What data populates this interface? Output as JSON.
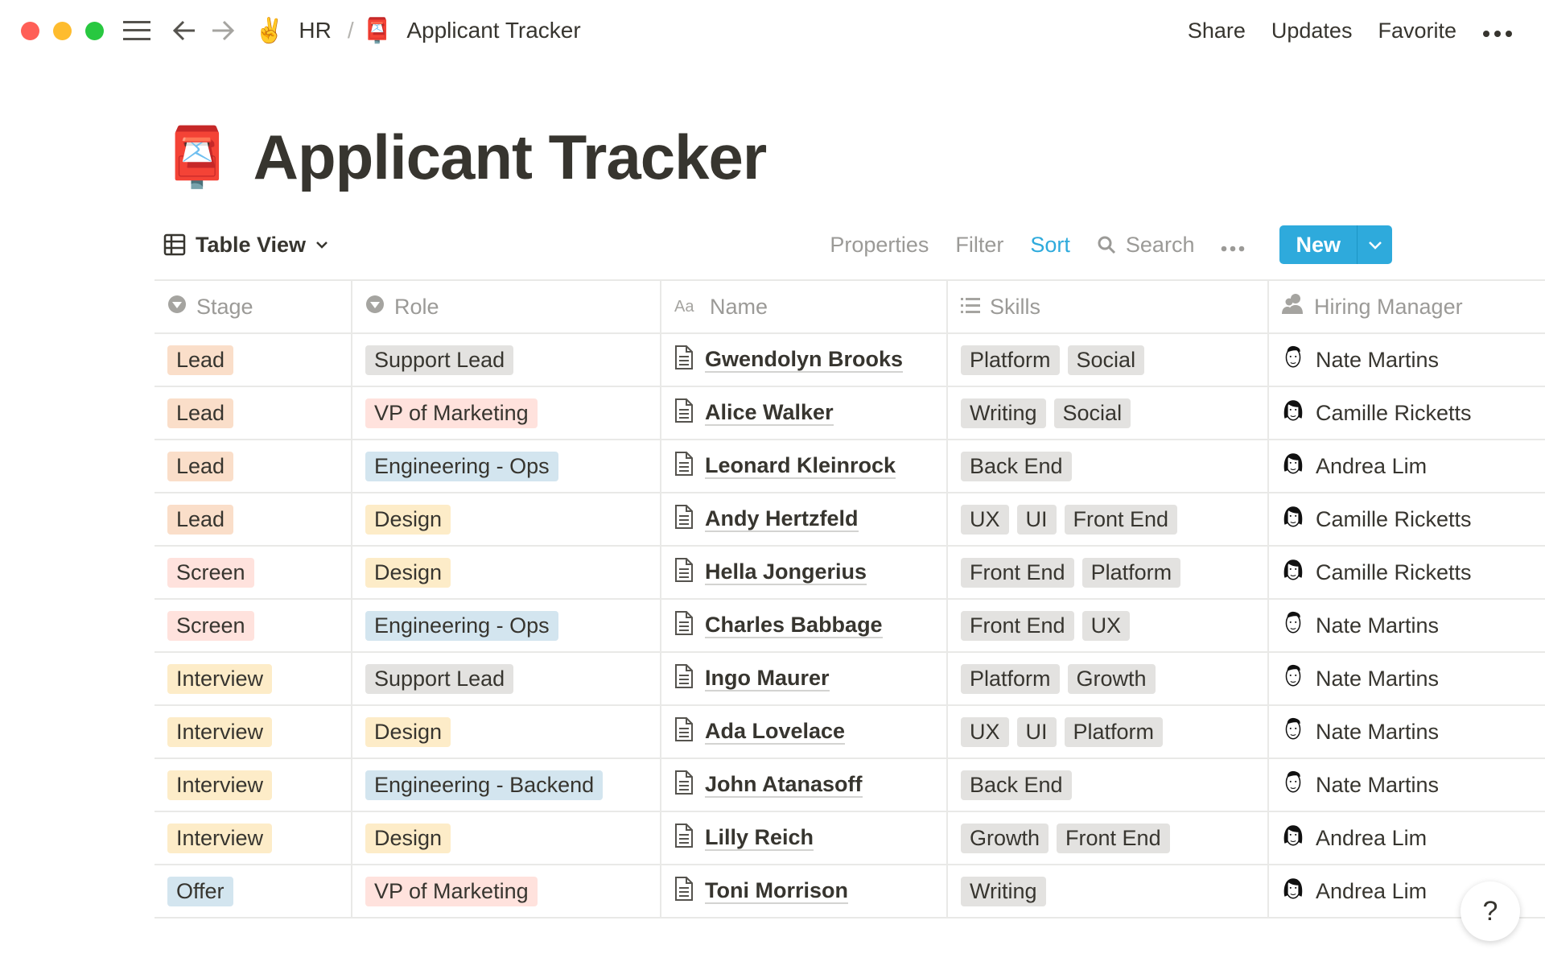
{
  "topbar": {
    "breadcrumb": [
      {
        "icon": "victory-hand-emoji",
        "label": "HR"
      },
      {
        "icon": "postbox-emoji",
        "label": "Applicant Tracker"
      }
    ],
    "separator": "/",
    "actions": [
      "Share",
      "Updates",
      "Favorite"
    ]
  },
  "page": {
    "title": "Applicant Tracker",
    "icon": "postbox-emoji"
  },
  "view": {
    "name": "Table View",
    "tools": {
      "properties": "Properties",
      "filter": "Filter",
      "sort": "Sort",
      "search": "Search"
    },
    "new_label": "New",
    "accent": "#2eaadc"
  },
  "columns": [
    "Stage",
    "Role",
    "Name",
    "Skills",
    "Hiring Manager"
  ],
  "colors": {
    "Lead": "#fadec9",
    "Screen": "#ffe2dd",
    "Interview": "#fdecc8",
    "Offer": "#d3e5ef",
    "Support Lead": "#e3e2e0",
    "VP of Marketing": "#ffe2dd",
    "Engineering - Ops": "#d3e5ef",
    "Engineering - Backend": "#d3e5ef",
    "Design": "#fdecc8",
    "skill": "#e3e2e0"
  },
  "rows": [
    {
      "stage": "Lead",
      "role": "Support Lead",
      "name": "Gwendolyn Brooks",
      "skills": [
        "Platform",
        "Social"
      ],
      "manager": "Nate Martins"
    },
    {
      "stage": "Lead",
      "role": "VP of Marketing",
      "name": "Alice Walker",
      "skills": [
        "Writing",
        "Social"
      ],
      "manager": "Camille Ricketts"
    },
    {
      "stage": "Lead",
      "role": "Engineering - Ops",
      "name": "Leonard Kleinrock",
      "skills": [
        "Back End"
      ],
      "manager": "Andrea Lim"
    },
    {
      "stage": "Lead",
      "role": "Design",
      "name": "Andy Hertzfeld",
      "skills": [
        "UX",
        "UI",
        "Front End"
      ],
      "manager": "Camille Ricketts"
    },
    {
      "stage": "Screen",
      "role": "Design",
      "name": "Hella Jongerius",
      "skills": [
        "Front End",
        "Platform"
      ],
      "manager": "Camille Ricketts"
    },
    {
      "stage": "Screen",
      "role": "Engineering - Ops",
      "name": "Charles Babbage",
      "skills": [
        "Front End",
        "UX"
      ],
      "manager": "Nate Martins"
    },
    {
      "stage": "Interview",
      "role": "Support Lead",
      "name": "Ingo Maurer",
      "skills": [
        "Platform",
        "Growth"
      ],
      "manager": "Nate Martins"
    },
    {
      "stage": "Interview",
      "role": "Design",
      "name": "Ada Lovelace",
      "skills": [
        "UX",
        "UI",
        "Platform"
      ],
      "manager": "Nate Martins"
    },
    {
      "stage": "Interview",
      "role": "Engineering - Backend",
      "name": "John Atanasoff",
      "skills": [
        "Back End"
      ],
      "manager": "Nate Martins"
    },
    {
      "stage": "Interview",
      "role": "Design",
      "name": "Lilly Reich",
      "skills": [
        "Growth",
        "Front End"
      ],
      "manager": "Andrea Lim"
    },
    {
      "stage": "Offer",
      "role": "VP of Marketing",
      "name": "Toni Morrison",
      "skills": [
        "Writing"
      ],
      "manager": "Andrea Lim"
    }
  ],
  "help_label": "?"
}
